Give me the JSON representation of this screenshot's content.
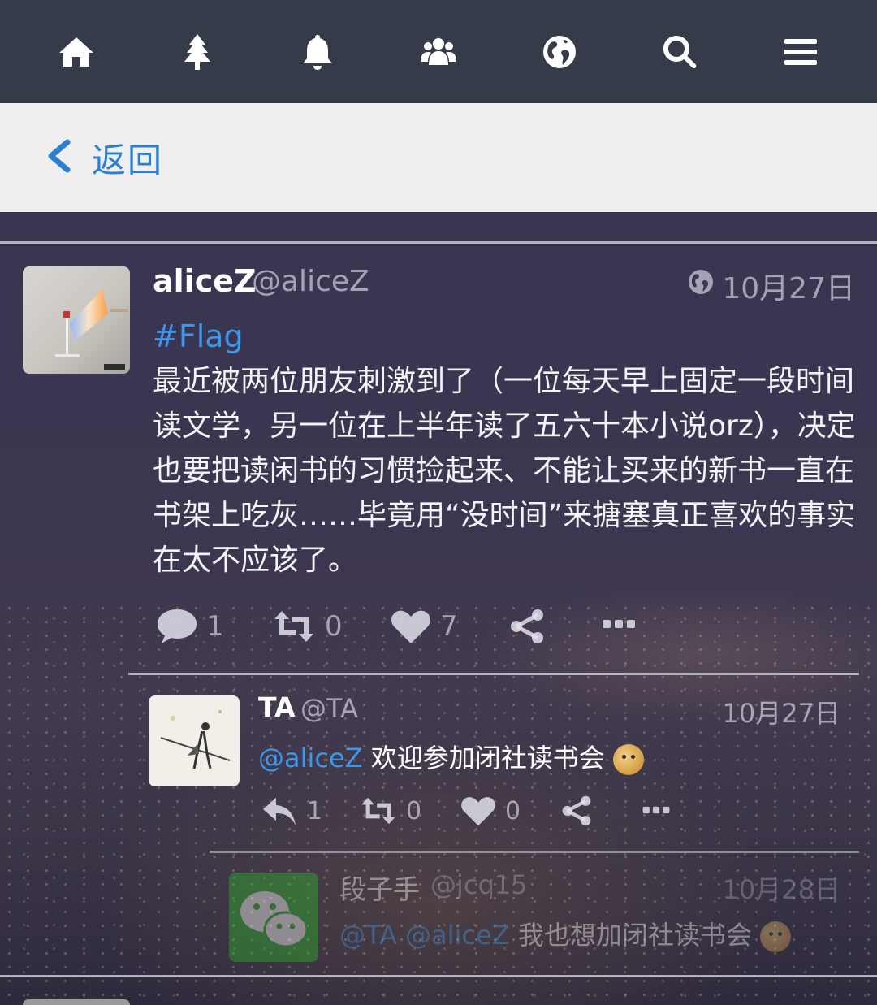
{
  "nav": {
    "items": [
      {
        "icon": "home-icon"
      },
      {
        "icon": "tree-icon"
      },
      {
        "icon": "bell-icon"
      },
      {
        "icon": "users-icon"
      },
      {
        "icon": "globe-icon"
      },
      {
        "icon": "search-icon"
      },
      {
        "icon": "menu-icon"
      }
    ]
  },
  "backbar": {
    "label": "返回"
  },
  "colors": {
    "accent": "#2a7fd0",
    "link": "#3d96e8",
    "nav_bg": "#363b4a"
  },
  "post": {
    "name": "aliceZ",
    "handle": "@aliceZ",
    "date": "10月27日",
    "hashtag": "#Flag",
    "body": "最近被两位朋友刺激到了（一位每天早上固定一段时间读文学，另一位在上半年读了五六十本小说orz），决定也要把读闲书的习惯捡起来、不能让买来的新书一直在书架上吃灰……毕竟用“没时间”来搪塞真正喜欢的事实在太不应该了。",
    "replies": "1",
    "reposts": "0",
    "likes": "7"
  },
  "reply1": {
    "name": "TA",
    "handle": "@TA",
    "date": "10月27日",
    "mention": "@aliceZ",
    "text": "欢迎参加闭社读书会",
    "replies": "1",
    "reposts": "0",
    "likes": "0"
  },
  "reply2": {
    "name": "段子手",
    "handle": "@jcq15",
    "date": "10月28日",
    "mention1": "@TA",
    "mention2": "@aliceZ",
    "text": "我也想加闭社读书会"
  }
}
